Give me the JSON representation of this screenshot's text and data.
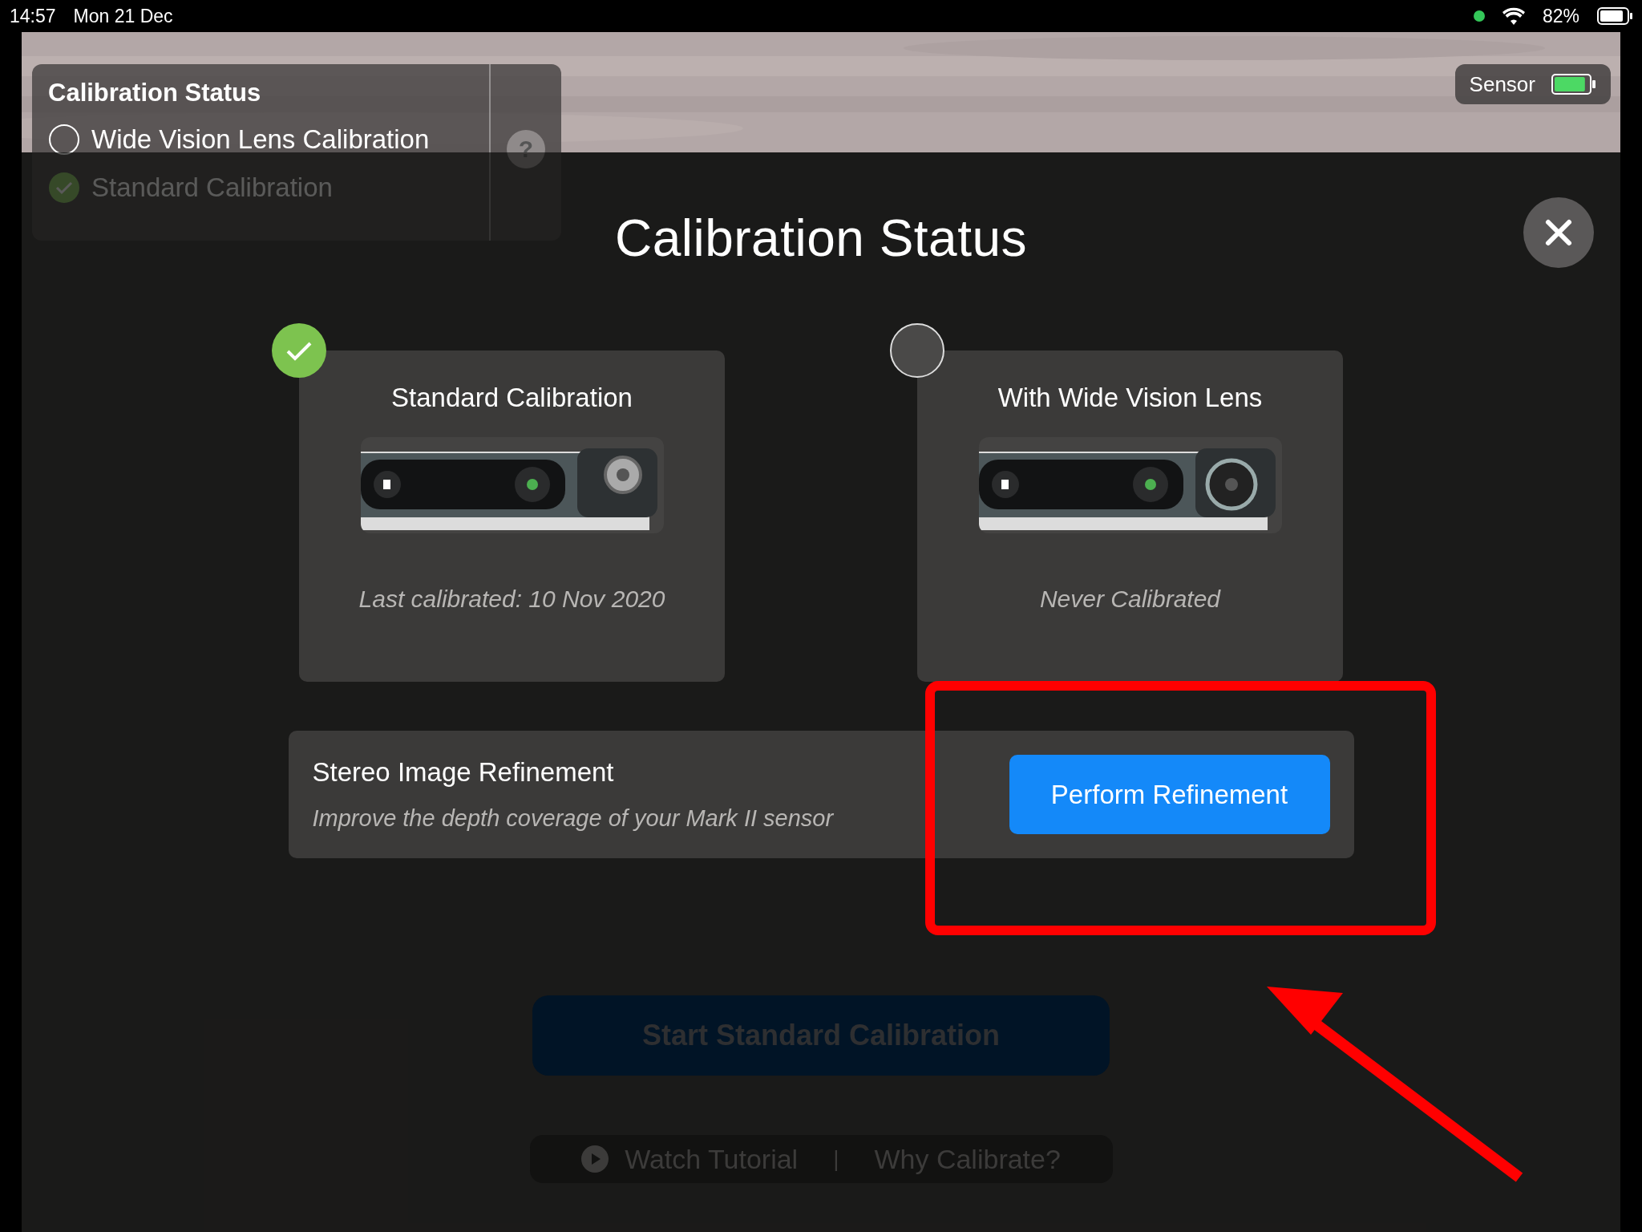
{
  "status_bar": {
    "time": "14:57",
    "date": "Mon 21 Dec",
    "battery": "82%"
  },
  "hud_panel": {
    "title": "Calibration Status",
    "items": [
      {
        "label": "Wide Vision Lens Calibration",
        "checked": false
      },
      {
        "label": "Standard Calibration",
        "checked": true
      }
    ],
    "help": "?"
  },
  "sensor": {
    "label": "Sensor",
    "level": 0.9
  },
  "modal": {
    "title": "Calibration Status",
    "cards": [
      {
        "title": "Standard Calibration",
        "kind": "standard",
        "checked": true,
        "note": "Last calibrated: 10 Nov 2020"
      },
      {
        "title": "With Wide Vision Lens",
        "kind": "wide",
        "checked": false,
        "note": "Never Calibrated"
      }
    ],
    "refinement": {
      "title": "Stereo Image Refinement",
      "subtitle": "Improve the depth coverage of your Mark II sensor",
      "button": "Perform Refinement"
    },
    "start_button": {
      "label": "Start Standard Calibration",
      "disabled": true
    },
    "links": [
      {
        "label": "Watch Tutorial",
        "kind": "video"
      },
      {
        "label": "Why Calibrate?",
        "kind": "plain"
      }
    ],
    "separator": "|"
  }
}
